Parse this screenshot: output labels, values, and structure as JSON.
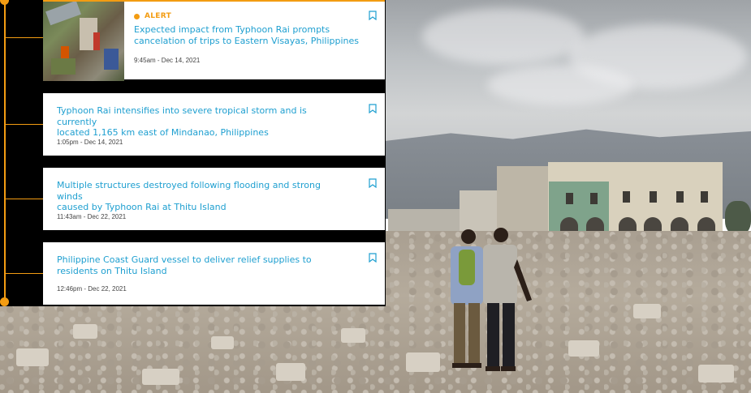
{
  "timeline": {
    "items": [
      {
        "badge": "ALERT",
        "title_line1": "Expected impact from Typhoon Rai prompts",
        "title_line2": "cancelation of trips to Eastern Visayas, Philippines",
        "timestamp": "9:45am - Dec 14, 2021",
        "has_image": true
      },
      {
        "title_line1": "Typhoon Rai intensifies into severe tropical storm and is currently",
        "title_line2": "located 1,165 km east of Mindanao, Philippines",
        "timestamp": "1:05pm - Dec 14, 2021"
      },
      {
        "title_line1": "Multiple structures destroyed following flooding and strong winds",
        "title_line2": "caused by Typhoon Rai at Thitu Island",
        "timestamp": "11:43am - Dec 22, 2021"
      },
      {
        "title_line1": "Philippine Coast Guard vessel to deliver relief supplies to",
        "title_line2": "residents on Thitu Island",
        "timestamp": "12:46pm - Dec 22, 2021"
      }
    ]
  },
  "colors": {
    "accent": "#f39c12",
    "link": "#1e9fd0",
    "panel_bg": "#000000"
  },
  "icons": {
    "bookmark": "bookmark-icon",
    "alert_dot": "alert-dot-icon"
  }
}
